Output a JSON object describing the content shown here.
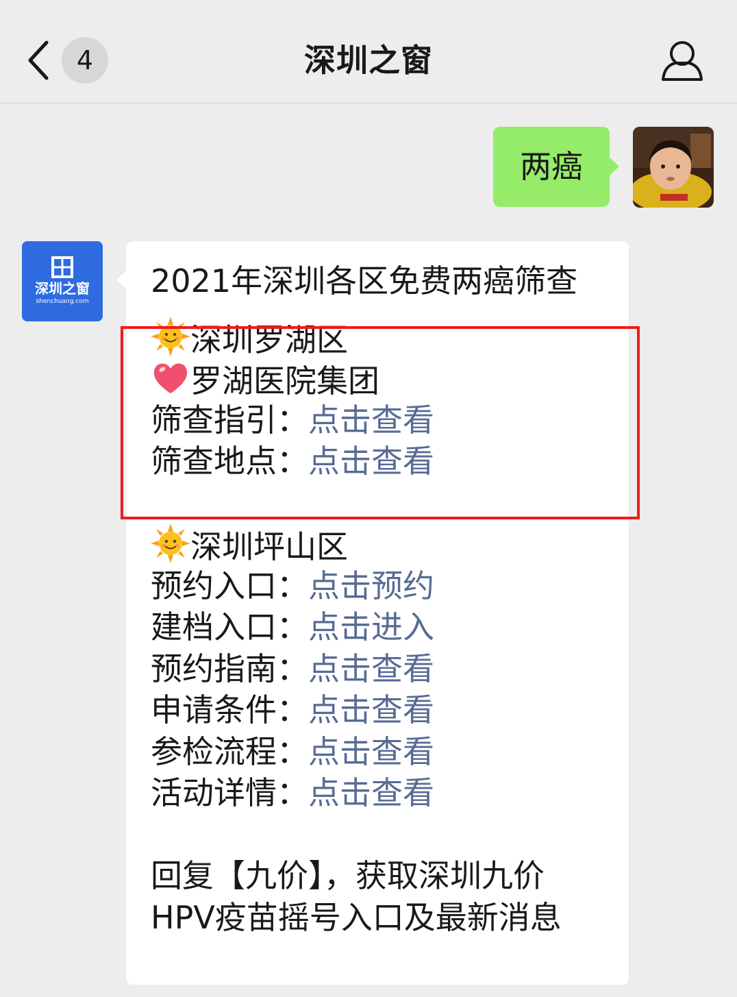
{
  "nav": {
    "unread_count": "4",
    "title": "深圳之窗",
    "back_icon": "chevron-left-icon",
    "profile_icon": "person-icon"
  },
  "outgoing": {
    "text": "两癌"
  },
  "incoming": {
    "title": "2021年深圳各区免费两癌筛查",
    "luohu": {
      "district": "深圳罗湖区",
      "hospital": "罗湖医院集团",
      "rows": [
        {
          "label": "筛查指引：",
          "link": "点击查看"
        },
        {
          "label": "筛查地点：",
          "link": "点击查看"
        }
      ]
    },
    "pingshan": {
      "district": "深圳坪山区",
      "rows": [
        {
          "label": "预约入口：",
          "link": "点击预约"
        },
        {
          "label": "建档入口：",
          "link": "点击进入"
        },
        {
          "label": "预约指南：",
          "link": "点击查看"
        },
        {
          "label": "申请条件：",
          "link": "点击查看"
        },
        {
          "label": "参检流程：",
          "link": "点击查看"
        },
        {
          "label": "活动详情：",
          "link": "点击查看"
        }
      ]
    },
    "footer": {
      "line1": "回复【九价】，获取深圳九价",
      "line2": "HPV疫苗摇号入口及最新消息"
    }
  },
  "oa_logo": {
    "name": "深圳之窗",
    "domain": "shenchuang.com"
  },
  "colors": {
    "background": "#ededed",
    "outgoing_bubble": "#95ec69",
    "link": "#576b95",
    "highlight": "#ee1c1c",
    "logo_bg": "#2f6be0"
  }
}
